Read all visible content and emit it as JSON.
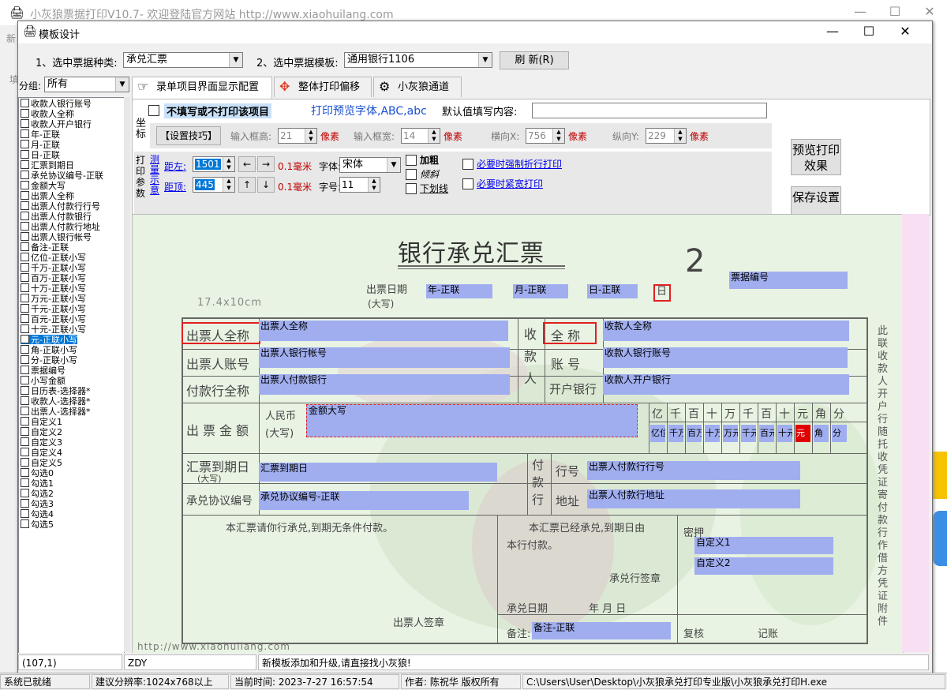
{
  "app": {
    "title": "小灰狼票据打印V10.7- 欢迎登陆官方网站 http://www.xiaohuilang.com",
    "menu_fragment": "新",
    "left_fragment": "填"
  },
  "dialog": {
    "title": "模板设计",
    "type_label": "1、选中票据种类:",
    "type_value": "承兑汇票",
    "template_label": "2、选中票据模板:",
    "template_value": "通用银行1106",
    "refresh_label": "刷 新(R)"
  },
  "group": {
    "label": "分组:",
    "value": "所有"
  },
  "fields": [
    "收款人银行账号",
    "收款人全称",
    "收款人开户银行",
    "年-正联",
    "月-正联",
    "日-正联",
    "汇票到期日",
    "承兑协议编号-正联",
    "金额大写",
    "出票人全称",
    "出票人付款行行号",
    "出票人付款银行",
    "出票人付款行地址",
    "出票人银行帐号",
    "备注-正联",
    "亿位-正联小写",
    "千万-正联小写",
    "百万-正联小写",
    "十万-正联小写",
    "万元-正联小写",
    "千元-正联小写",
    "百元-正联小写",
    "十元-正联小写",
    "元-正联小写",
    "角-正联小写",
    "分-正联小写",
    "票据编号",
    "小写金额",
    "日历表-选择器*",
    "收款人-选择器*",
    "出票人-选择器*",
    "自定义1",
    "自定义2",
    "自定义3",
    "自定义4",
    "自定义5",
    "勾选0",
    "勾选1",
    "勾选2",
    "勾选3",
    "勾选4",
    "勾选5"
  ],
  "selected_index": 23,
  "tabs": [
    {
      "label": "录单项目界面显示配置",
      "icon": "hand-icon"
    },
    {
      "label": "整体打印偏移",
      "icon": "move-icon"
    },
    {
      "label": "小灰狼通道",
      "icon": "gear-icon"
    }
  ],
  "panel": {
    "no_print_label": "不填写或不打印该项目",
    "preview_font_label": "打印预览字体,ABC,abc",
    "default_value_label": "默认值填写内容:",
    "coord_label": "坐标",
    "tips_button": "【设置技巧】",
    "input_height_label": "输入框高:",
    "input_height": "21",
    "input_width_label": "输入框宽:",
    "input_width": "14",
    "unit_px": "像素",
    "x_label": "横向X:",
    "x_value": "756",
    "y_label": "纵向Y:",
    "y_value": "229",
    "print_params_label": "打印参数",
    "measure_label": "测量示意",
    "left_label": "距左:",
    "left_value": "1501",
    "top_label": "距顶:",
    "top_value": "445",
    "unit_mm": "0.1毫米",
    "font_label": "字体:",
    "font_value": "宋体",
    "size_label": "字号:",
    "size_value": "11",
    "bold_label": "加粗",
    "italic_label": "倾斜",
    "underline_label": "下划线",
    "wrap_label": "必要时强制折行打印",
    "compress_label": "必要时紧宽打印",
    "preview_button": "预览打印效果",
    "save_button": "保存设置"
  },
  "canvas": {
    "bill_title": "银行承兑汇票",
    "bill_number_digit": "2",
    "draw_date_label": "出票日期",
    "draw_date_sub": "(大写)",
    "year_char": "年",
    "month_char": "月",
    "day_char": "日",
    "size_mark": "17.4x10cm",
    "payer_name": "出票人全称",
    "payer_account": "出票人账号",
    "payer_bank": "付款行全称",
    "amount_label": "出票金额",
    "rmb_label": "人民币",
    "rmb_sub": "(大写)",
    "due_label": "汇票到期日",
    "due_sub": "(大写)",
    "agreement_label": "承兑协议编号",
    "payee_vertical": "收款人",
    "payee_full": "全   称",
    "payee_account": "账   号",
    "payee_bank": "开户银行",
    "pay_bank_vertical": "付款行",
    "row_number": "行号",
    "address": "地址",
    "digits": [
      "亿",
      "千",
      "百",
      "十",
      "万",
      "千",
      "百",
      "十",
      "元",
      "角",
      "分"
    ],
    "promise_text": "本汇票请你行承兑,到期无条件付款。",
    "accepted_text": "本汇票已经承兑,到期日由",
    "accepted_text2": "本行付款。",
    "accept_sign": "承兑行签章",
    "accept_date": "承兑日期",
    "accept_ymd": "年    月    日",
    "remark": "备注:",
    "drawer_sign": "出票人签章",
    "secret": "密押",
    "review": "复核",
    "record": "记账",
    "side_text": "此联收款人开户行随托收凭证寄付款行作借方凭证附件",
    "url_mark": "http://www.xiaohuilang.com",
    "fields": {
      "year": "年-正联",
      "month": "月-正联",
      "day": "日-正联",
      "bill_no": "票据编号",
      "payer_name": "出票人全称",
      "payer_account": "出票人银行帐号",
      "payer_bank": "出票人付款银行",
      "amount_words": "金额大写",
      "due": "汇票到期日",
      "agreement": "承兑协议编号-正联",
      "payee_name": "收款人全称",
      "payee_account": "收款人银行账号",
      "payee_bank": "收款人开户银行",
      "drawer_bank_no": "出票人付款行行号",
      "drawer_bank_addr": "出票人付款行地址",
      "custom1": "自定义1",
      "custom2": "自定义2",
      "remark": "备注-正联"
    },
    "digit_fields": [
      "亿位",
      "千万",
      "百万",
      "十万",
      "万元",
      "千元",
      "百元",
      "十元",
      "元",
      "角",
      "分"
    ]
  },
  "dialog_status": {
    "coords": "(107,1)",
    "user": "ZDY",
    "message": "新模板添加和升级,请直接找小灰狼!"
  },
  "statusbar": {
    "ready": "系统已就绪",
    "resolution": "建议分辨率:1024x768以上",
    "time": "当前时间: 2023-7-27 16:57:54",
    "author": "作者: 陈祝华 版权所有",
    "path": "C:\\Users\\User\\Desktop\\小灰狼承兑打印专业版\\小灰狼承兑打印H.exe"
  },
  "colors": {
    "field_fill": "#a0aef0",
    "highlight": "#e02020",
    "selection": "#0078d7"
  }
}
